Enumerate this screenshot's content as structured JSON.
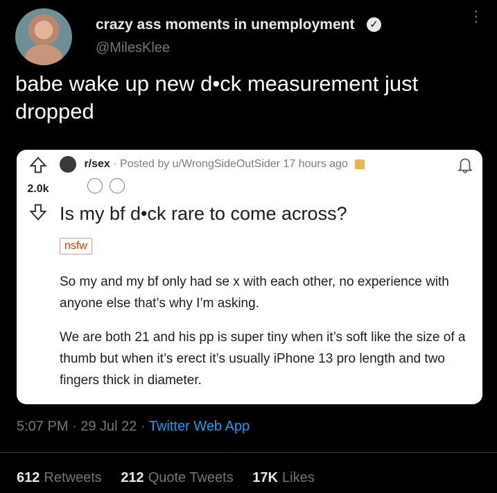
{
  "author": {
    "display_name": "crazy ass moments in unemployment",
    "handle": "@MilesKlee"
  },
  "tweet": {
    "text_line1": "babe wake up new d•ck measurement just",
    "text_line2": "dropped"
  },
  "reddit_post": {
    "subreddit": "r/sex",
    "posted_by": "· Posted by u/WrongSideOutSider 17 hours ago",
    "score": "2.0k",
    "title": "Is my bf d•ck rare to come across?",
    "flair": "nsfw",
    "paragraph1": "So my and my bf only had se x with each other, no experience with anyone else that’s why I’m asking.",
    "paragraph2": "We are both 21 and his pp is super tiny when it’s soft like the size of a thumb but when it’s erect it’s usually iPhone 13 pro length and two fingers thick in diameter."
  },
  "meta": {
    "timestamp": "5:07 PM · 29 Jul 22 · ",
    "source": "Twitter Web App"
  },
  "stats": {
    "retweets_count": "612",
    "retweets_label": "Retweets",
    "quotes_count": "212",
    "quotes_label": "Quote Tweets",
    "likes_count": "17K",
    "likes_label": "Likes"
  },
  "icons": {
    "verified": "verified-badge-icon",
    "more": "more-options-icon",
    "upvote": "upvote-arrow-icon",
    "downvote": "downvote-arrow-icon",
    "bell": "bell-icon",
    "lock": "lock-icon"
  }
}
